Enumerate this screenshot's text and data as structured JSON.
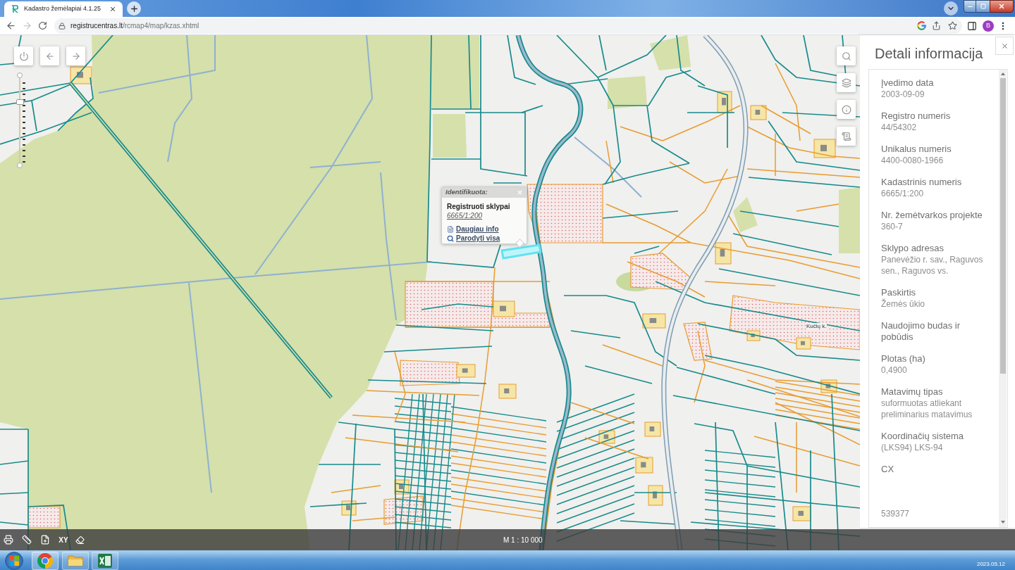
{
  "browser": {
    "tabs": [
      {
        "title": "Kadastro žemėlapiai 4.1.25",
        "selected": true
      }
    ],
    "nav": {
      "forward_disabled": true
    },
    "url": {
      "domain": "registrucentras.lt",
      "path": "/rcmap4/map/kzas.xhtml"
    },
    "profile_initial": "B"
  },
  "map": {
    "zoom": {
      "level": 0.71
    },
    "place_labels": [
      {
        "text": "Kučių k."
      }
    ],
    "popup": {
      "title": "Identifikuota:",
      "heading": "Registruoti sklypai",
      "parcel_link": "6665/1:200",
      "links": [
        {
          "kind": "info",
          "label": "Daugiau info"
        },
        {
          "kind": "zoom",
          "label": "Parodyti visa"
        }
      ]
    }
  },
  "panel": {
    "title": "Detali informacija",
    "fields": [
      {
        "label": "Įvedimo data",
        "value": "2003-09-09"
      },
      {
        "label": "Registro numeris",
        "value": "44/54302"
      },
      {
        "label": "Unikalus numeris",
        "value": "4400-0080-1966"
      },
      {
        "label": "Kadastrinis numeris",
        "value": "6665/1:200"
      },
      {
        "label": "Nr. žemėtvarkos projekte",
        "value": "360-7"
      },
      {
        "label": "Sklypo adresas",
        "value": "Panevėžio r. sav., Raguvos sen., Raguvos vs."
      },
      {
        "label": "Paskirtis",
        "value": "Žemės ūkio"
      },
      {
        "label": "Naudojimo budas ir pobūdis"
      },
      {
        "label": "Plotas (ha)",
        "value": "0,4900"
      },
      {
        "label": "Matavimų tipas",
        "value": "suformuotas atliekant preliminarius matavimus"
      },
      {
        "label": "Koordinačių sistema",
        "value": "(LKS94) LKS-94"
      },
      {
        "label": "CX"
      },
      {
        "value": "539377"
      }
    ]
  },
  "map_toolbar": {
    "xy_button": "XY",
    "scale": "M 1 : 10 000"
  },
  "taskbar": {
    "date": "2023.05.12"
  }
}
